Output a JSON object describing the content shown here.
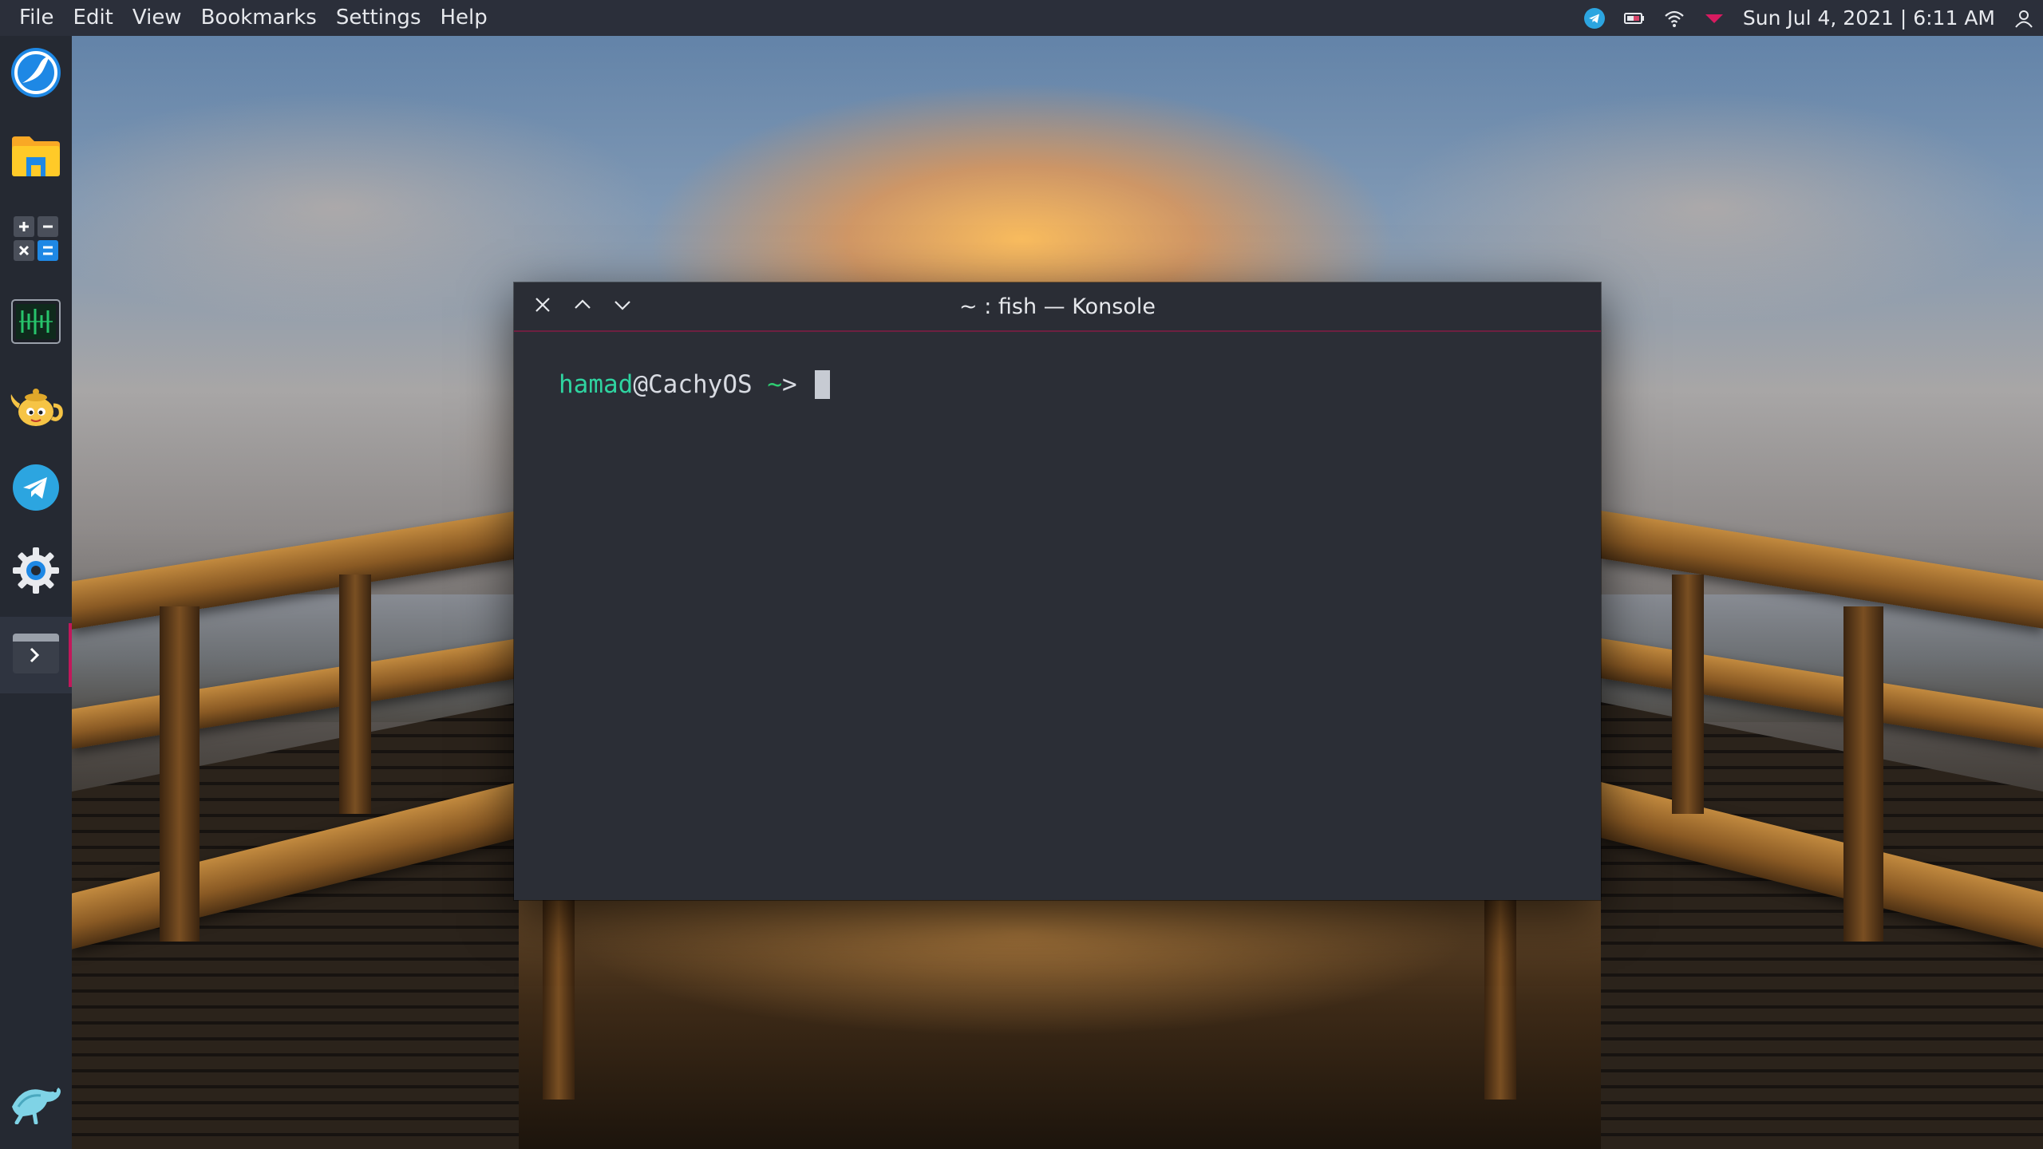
{
  "menubar": {
    "items": [
      {
        "label": "File"
      },
      {
        "label": "Edit"
      },
      {
        "label": "View"
      },
      {
        "label": "Bookmarks"
      },
      {
        "label": "Settings"
      },
      {
        "label": "Help"
      }
    ],
    "tray": {
      "icons": [
        "telegram-tray-icon",
        "battery-icon",
        "wifi-icon",
        "notifications-arrow-icon"
      ],
      "clock": "Sun Jul 4, 2021 | 6:11 AM",
      "user_icon": "user-icon"
    }
  },
  "dock": {
    "items": [
      {
        "name": "browser-launcher",
        "icon": "browser-icon"
      },
      {
        "name": "file-manager-launcher",
        "icon": "folder-icon"
      },
      {
        "name": "calculator-launcher",
        "icon": "calculator-icon"
      },
      {
        "name": "system-monitor-launcher",
        "icon": "system-monitor-icon"
      },
      {
        "name": "teapot-launcher",
        "icon": "teapot-icon"
      },
      {
        "name": "telegram-launcher",
        "icon": "telegram-icon"
      },
      {
        "name": "settings-launcher",
        "icon": "gear-icon"
      },
      {
        "name": "konsole-launcher",
        "icon": "terminal-icon",
        "active": true
      }
    ],
    "bottom": {
      "name": "distro-logo",
      "icon": "turtle-logo-icon"
    }
  },
  "window": {
    "title": "~ : fish — Konsole",
    "buttons": [
      "close-icon",
      "chevron-up-icon",
      "chevron-down-icon"
    ]
  },
  "terminal": {
    "user": "hamad",
    "at": "@",
    "host": "CachyOS",
    "cwd": " ~",
    "prompt_char": "> "
  },
  "colors": {
    "accent": "#c2185b",
    "prompt_user": "#2fd4a0",
    "prompt_cwd": "#2ecc71",
    "panel_bg": "#2b2f3a",
    "terminal_bg": "#2b2e36"
  }
}
